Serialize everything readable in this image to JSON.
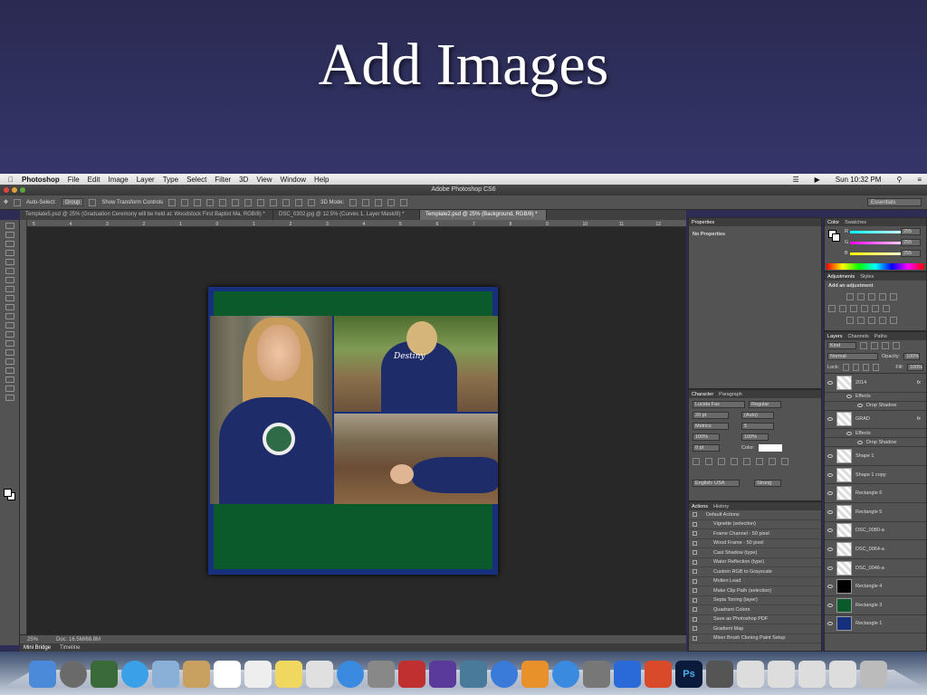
{
  "slide": {
    "title": "Add Images"
  },
  "menubar": {
    "apple": "",
    "app": "Photoshop",
    "items": [
      "File",
      "Edit",
      "Image",
      "Layer",
      "Type",
      "Select",
      "Filter",
      "3D",
      "View",
      "Window",
      "Help"
    ],
    "clock": "Sun 10:32 PM"
  },
  "window": {
    "title": "Adobe Photoshop CS6"
  },
  "options": {
    "auto_select": "Auto-Select:",
    "group": "Group",
    "show_transform": "Show Transform Controls",
    "mode3d": "3D Mode:",
    "workspace": "Essentials"
  },
  "tabs": [
    {
      "label": "Template5.psd @ 25% (Graduation Ceremony will be held at: Woodstock First Baptist Ma, RGB/8) *"
    },
    {
      "label": "DSC_0302.jpg @ 12.5% (Curves 1, Layer Mask/8) *"
    },
    {
      "label": "Template2.psd @ 25% (Background, RGB/8) *"
    }
  ],
  "ruler": [
    "5",
    "4",
    "3",
    "2",
    "1",
    "0",
    "1",
    "2",
    "3",
    "4",
    "5",
    "6",
    "7",
    "8",
    "9",
    "10",
    "11",
    "12"
  ],
  "status": {
    "zoom": "25%",
    "doc": "Doc: 16.5M/68.8M"
  },
  "bottom_tabs": [
    "Mini Bridge",
    "Timeline"
  ],
  "properties": {
    "tabs": [
      "Properties"
    ],
    "text": "No Properties"
  },
  "character": {
    "tabs": [
      "Character",
      "Paragraph"
    ],
    "font": "Lucida Fax",
    "style": "Regular",
    "size": "20 pt",
    "leading": "(Auto)",
    "kerning": "Metrics",
    "tracking": "5",
    "vscale": "100%",
    "hscale": "100%",
    "baseline": "0 pt",
    "color_label": "Color:",
    "language": "English: USA",
    "aa": "Strong"
  },
  "actions": {
    "tabs": [
      "Actions",
      "History"
    ],
    "items": [
      "Default Actions",
      "Vignette (selection)",
      "Frame Channel - 50 pixel",
      "Wood Frame - 50 pixel",
      "Cast Shadow (type)",
      "Water Reflection (type)",
      "Custom RGB to Grayscale",
      "Molten Lead",
      "Make Clip Path (selection)",
      "Sepia Toning (layer)",
      "Quadrant Colors",
      "Save as Photoshop PDF",
      "Gradient Map",
      "Mixer Brush Cloning Paint Setup"
    ]
  },
  "color_panel": {
    "tabs": [
      "Color",
      "Swatches"
    ],
    "r": "255",
    "g": "255",
    "b": "255",
    "r_label": "R",
    "g_label": "G",
    "b_label": "B"
  },
  "adjustments": {
    "tabs": [
      "Adjustments",
      "Styles"
    ],
    "label": "Add an adjustment"
  },
  "layers_panel": {
    "tabs": [
      "Layers",
      "Channels",
      "Paths"
    ],
    "kind": "Kind",
    "blend": "Normal",
    "opacity_label": "Opacity:",
    "opacity": "100%",
    "lock_label": "Lock:",
    "fill_label": "Fill:",
    "fill": "100%",
    "layers": [
      {
        "name": "2014",
        "fx": "fx"
      },
      {
        "name": "Effects"
      },
      {
        "name": "Drop Shadow"
      },
      {
        "name": "GRAD",
        "fx": "fx"
      },
      {
        "name": "Effects"
      },
      {
        "name": "Drop Shadow"
      },
      {
        "name": "Shape 1"
      },
      {
        "name": "Shape 1 copy"
      },
      {
        "name": "Rectangle 6"
      },
      {
        "name": "Rectangle 5"
      },
      {
        "name": "DSC_0080-a"
      },
      {
        "name": "DSC_0064-a"
      },
      {
        "name": "DSC_0046-a"
      },
      {
        "name": "Rectangle 4"
      },
      {
        "name": "Rectangle 3"
      },
      {
        "name": "Rectangle 1"
      }
    ]
  },
  "photos": {
    "p2_text": "Destiny"
  },
  "colors": {
    "accent_blue": "#17307c",
    "green": "#0b5a2c"
  }
}
